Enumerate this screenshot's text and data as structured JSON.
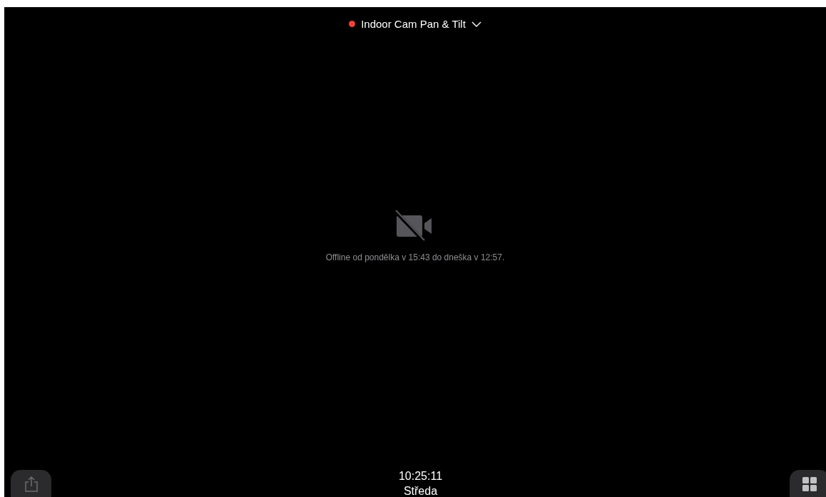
{
  "camera_selector": {
    "label": "Indoor Cam Pan & Tilt",
    "live": true
  },
  "status": {
    "message": "Offline od pondělka v 15:43 do dneška v 12:57."
  },
  "clock": {
    "time": "10:25:11",
    "day": "Středa"
  }
}
